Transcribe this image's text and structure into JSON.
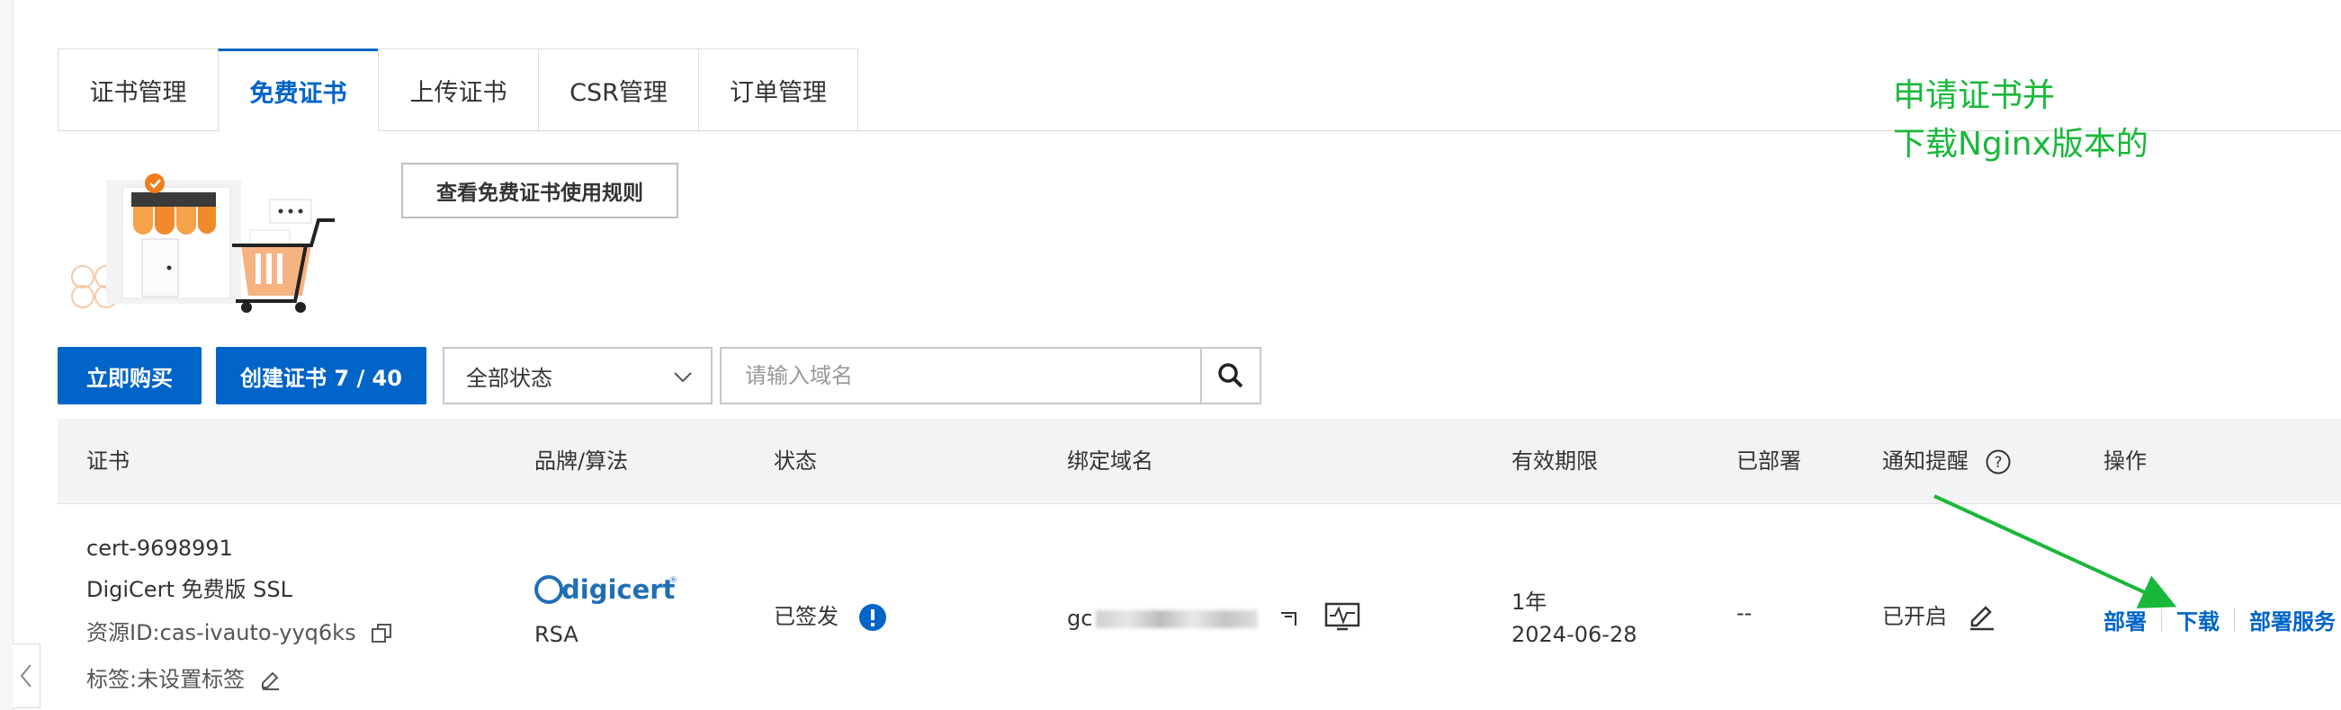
{
  "tabs": [
    {
      "label": "证书管理",
      "active": false
    },
    {
      "label": "免费证书",
      "active": true
    },
    {
      "label": "上传证书",
      "active": false
    },
    {
      "label": "CSR管理",
      "active": false
    },
    {
      "label": "订单管理",
      "active": false
    }
  ],
  "annotation": {
    "line1": "申请证书并",
    "line2": "下载Nginx版本的"
  },
  "rules_button": "查看免费证书使用规则",
  "toolbar": {
    "buy_label": "立即购买",
    "create_label": "创建证书 7 / 40",
    "status_select": "全部状态",
    "search_placeholder": "请输入域名"
  },
  "table": {
    "headers": {
      "cert": "证书",
      "brand": "品牌/算法",
      "status": "状态",
      "domain": "绑定域名",
      "validity": "有效期限",
      "deployed": "已部署",
      "notify": "通知提醒",
      "actions": "操作"
    },
    "row": {
      "cert_name": "cert-9698991",
      "cert_type": "DigiCert 免费版 SSL",
      "resource_id": "资源ID:cas-ivauto-yyq6ks",
      "tag": "标签:未设置标签",
      "brand_logo": "digicert",
      "algorithm": "RSA",
      "status": "已签发",
      "domain_prefix": "gc",
      "validity_period": "1年",
      "validity_date": "2024-06-28",
      "deployed": "--",
      "notify": "已开启",
      "action_deploy": "部署",
      "action_download": "下载",
      "action_service": "部署服务"
    }
  },
  "colors": {
    "accent": "#0064c8",
    "annotation": "#19b83a",
    "header_bg": "#f2f3f5"
  }
}
